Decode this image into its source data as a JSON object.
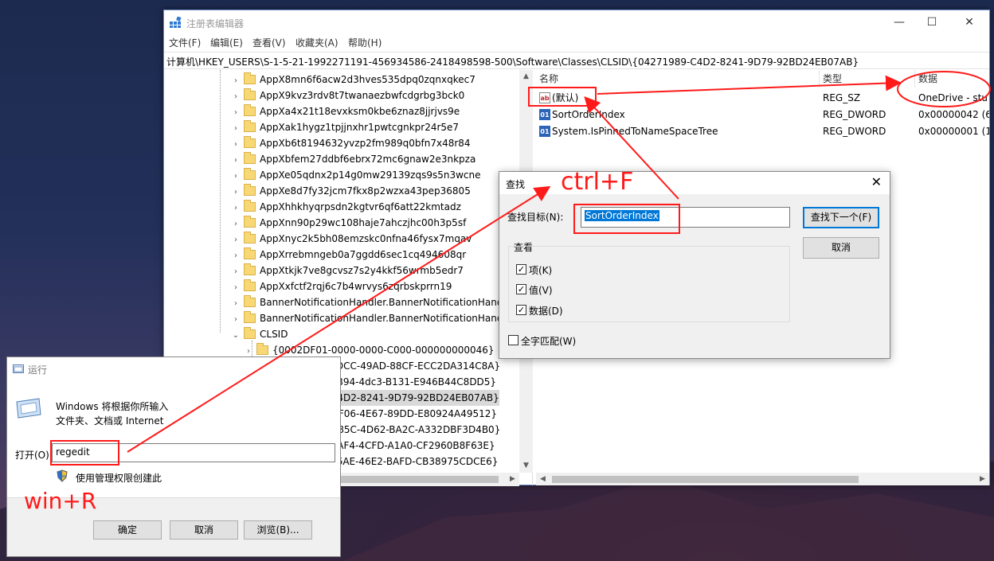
{
  "regedit": {
    "title": "注册表编辑器",
    "window_controls": {
      "minimize": "—",
      "maximize": "☐",
      "close": "✕"
    },
    "menu": [
      "文件(F)",
      "编辑(E)",
      "查看(V)",
      "收藏夹(A)",
      "帮助(H)"
    ],
    "address": "计算机\\HKEY_USERS\\S-1-5-21-1992271191-456934586-2418498598-500\\Software\\Classes\\CLSID\\{04271989-C4D2-8241-9D79-92BD24EB07AB}",
    "tree": {
      "app_items": [
        "AppX8mn6f6acw2d3hves535dpq0zqnxqkec7",
        "AppX9kvz3rdv8t7twanaezbwfcdgrbg3bck0",
        "AppXa4x21t18evxksm0kbe6znaz8jjrjvs9e",
        "AppXak1hygz1tpjjnxhr1pwtcgnkpr24r5e7",
        "AppXb6t8194632yvzp2fm989q0bfn7x48r84",
        "AppXbfem27ddbf6ebrx72mc6gnaw2e3nkpza",
        "AppXe05qdnx2p14g0mw29139zqs9s5n3wcne",
        "AppXe8d7fy32jcm7fkx8p2wzxa43pep36805",
        "AppXhhkhyqrpsdn2kgtvr6qf6att22kmtadz",
        "AppXnn90p29wc108haje7ahczjhc00h3p5sf",
        "AppXnyc2k5bh08emzskc0nfna46fysx7mqav",
        "AppXrrebmngeb0a7ggdd6sec1cq494608qr",
        "AppXtkjk7ve8gcvsz7s2y4kkf56wrmb5edr7",
        "AppXxfctf2rqj6c7b4wrvys6zqrbskprrn19",
        "BannerNotificationHandler.BannerNotificationHandl",
        "BannerNotificationHandler.BannerNotificationHandl"
      ],
      "clsid_label": "CLSID",
      "clsid_children": [
        "{0002DF01-0000-0000-C000-000000000046}",
        "{021E4F06-9DCC-49AD-88CF-ECC2DA314C8A}",
        "{031E4825-7B94-4dc3-B131-E946B44C8DD5}",
        "{04271989-C4D2-8241-9D79-92BD24EB07AB}",
        "{07CA83F0-DF06-4E67-89DD-E80924A49512}",
        "{0827D883-485C-4D62-BA2C-A332DBF3D4B0}",
        "{1BF42E4C-4AF4-4CFD-A1A0-CF2960B8F63E}",
        "{20894375-46AE-46E2-BAFD-CB38975CDCE6}"
      ]
    },
    "values": {
      "headers": {
        "name": "名称",
        "type": "类型",
        "data": "数据"
      },
      "rows": [
        {
          "icon": "string-value-icon",
          "name": "(默认)",
          "type": "REG_SZ",
          "data": "OneDrive - stu"
        },
        {
          "icon": "dword-value-icon",
          "name": "SortOrderIndex",
          "type": "REG_DWORD",
          "data": "0x00000042 (6"
        },
        {
          "icon": "dword-value-icon",
          "name": "System.IsPinnedToNameSpaceTree",
          "type": "REG_DWORD",
          "data": "0x00000001 (1"
        }
      ]
    }
  },
  "find_dialog": {
    "title": "查找",
    "target_label": "查找目标(N):",
    "target_value": "SortOrderIndex",
    "find_next": "查找下一个(F)",
    "cancel": "取消",
    "look_at_label": "查看",
    "options": [
      {
        "label": "项(K)",
        "checked": true
      },
      {
        "label": "值(V)",
        "checked": true
      },
      {
        "label": "数据(D)",
        "checked": true
      }
    ],
    "match_whole": {
      "label": "全字匹配(W)",
      "checked": false
    }
  },
  "run_dialog": {
    "title": "运行",
    "description_line1": "Windows 将根据你所输入",
    "description_line2": "文件夹、文档或 Internet",
    "open_label": "打开(O):",
    "open_value": "regedit",
    "admin_text": "使用管理权限创建此",
    "ok": "确定",
    "cancel": "取消",
    "browse": "浏览(B)..."
  },
  "annotations": {
    "win_r": "win+R",
    "ctrl_f": "ctrl+F",
    "color": "#ff1a1a"
  }
}
